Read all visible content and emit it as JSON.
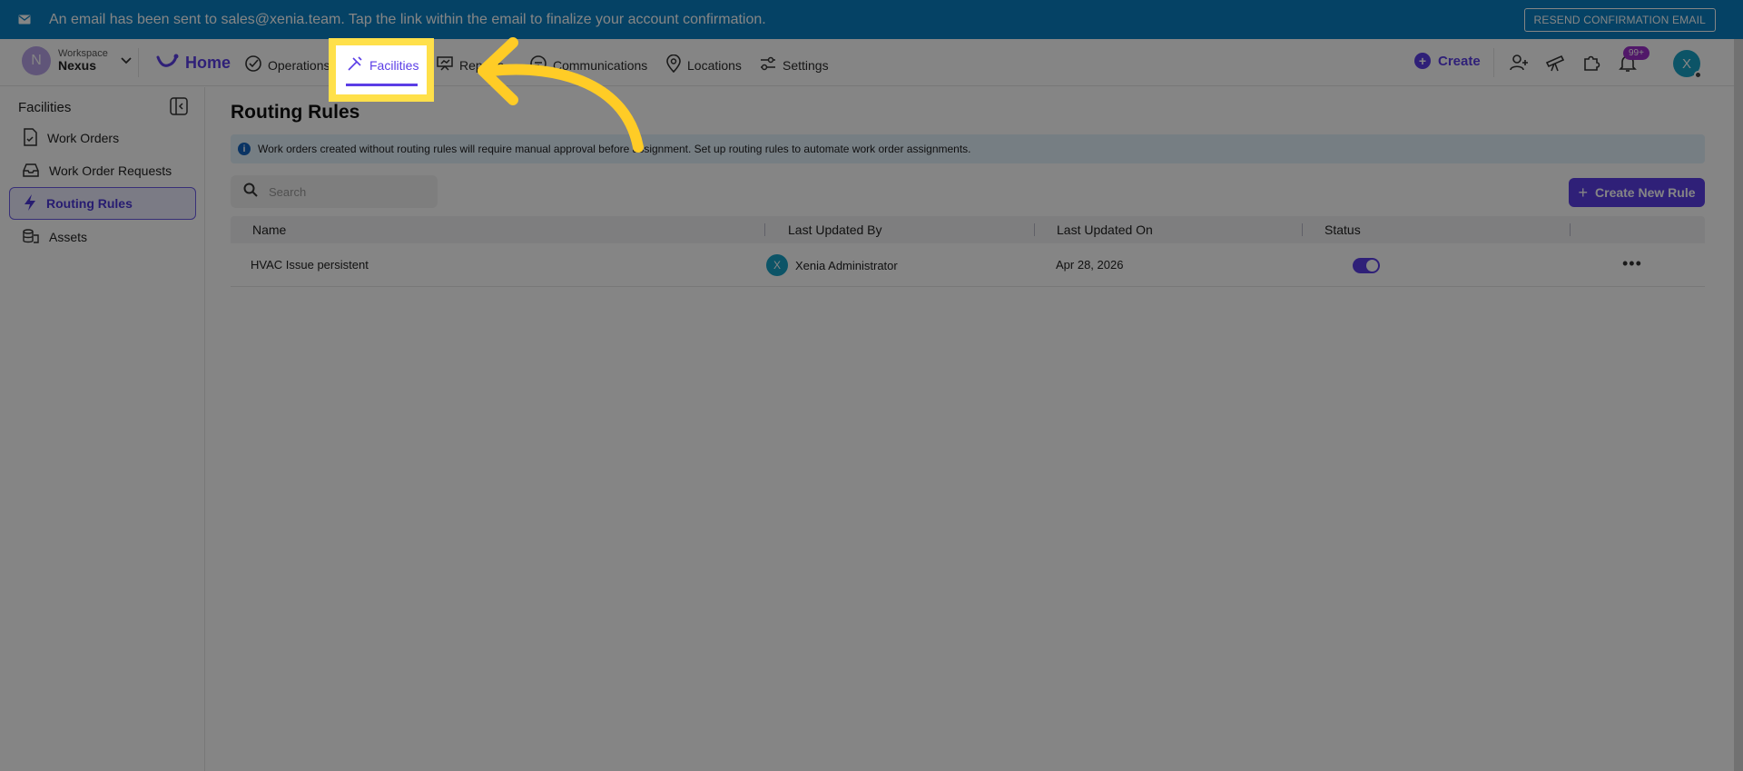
{
  "banner": {
    "message": "An email has been sent to sales@xenia.team. Tap the link within the email to finalize your account confirmation.",
    "resend_label": "RESEND CONFIRMATION EMAIL"
  },
  "workspace": {
    "initial": "N",
    "label": "Workspace",
    "name": "Nexus"
  },
  "nav": {
    "home": "Home",
    "items": [
      "Operations",
      "Facilities",
      "Reports",
      "Communications",
      "Locations",
      "Settings"
    ],
    "active": "Facilities",
    "create": "Create",
    "notification_count": "99+",
    "user_initial": "X"
  },
  "sidebar": {
    "title": "Facilities",
    "items": [
      "Work Orders",
      "Work Order Requests",
      "Routing Rules",
      "Assets"
    ],
    "active": "Routing Rules"
  },
  "main": {
    "title": "Routing Rules",
    "info": "Work orders created without routing rules will require manual approval before assignment. Set up routing rules to automate work order assignments.",
    "search_placeholder": "Search",
    "create_button": "Create New Rule",
    "columns": [
      "Name",
      "Last Updated By",
      "Last Updated On",
      "Status"
    ],
    "rows": [
      {
        "name": "HVAC Issue persistent",
        "updated_by_initial": "X",
        "updated_by": "Xenia Administrator",
        "updated_on": "Apr 28, 2026",
        "status_enabled": true
      }
    ]
  },
  "colors": {
    "accent": "#5b3ee6",
    "banner": "#0a7fc1",
    "highlight": "#ffe04a"
  }
}
